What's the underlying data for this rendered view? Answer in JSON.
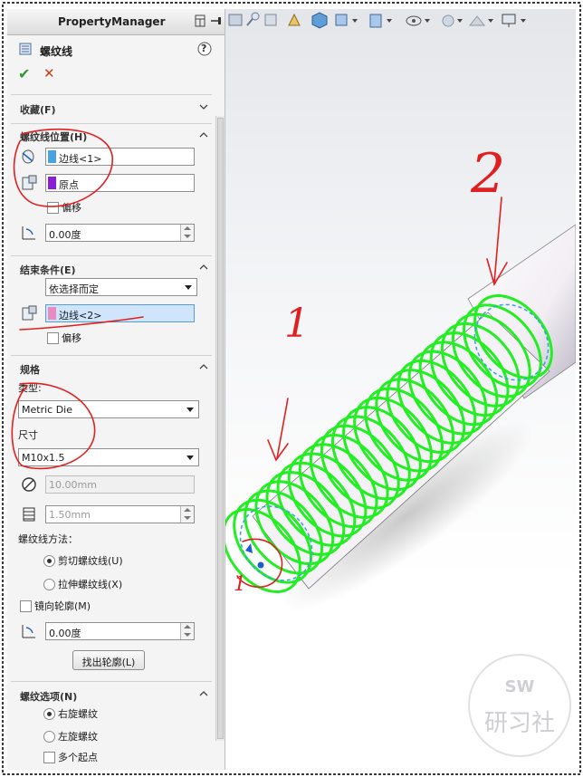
{
  "property_manager": {
    "title": "PropertyManager",
    "feature_name": "螺纹线",
    "help": "?",
    "ok": "✔",
    "cancel": "✕"
  },
  "favorites": {
    "header": "收藏(F)"
  },
  "thread_location": {
    "header": "螺纹线位置(H)",
    "edge_value": "边线<1>",
    "origin_value": "原点",
    "offset_label": "偏移",
    "angle_value": "0.00度"
  },
  "end_condition": {
    "header": "结束条件(E)",
    "type_value": "依选择而定",
    "edge_value": "边线<2>",
    "offset_label": "偏移"
  },
  "specification": {
    "header": "规格",
    "type_label": "类型:",
    "type_value": "Metric Die",
    "size_label": "尺寸",
    "size_value": "M10x1.5",
    "diameter_value": "10.00mm",
    "pitch_value": "1.50mm",
    "method_label": "螺纹线方法：",
    "method_cut": "剪切螺纹线(U)",
    "method_extrude": "拉伸螺纹线(X)",
    "mirror_label": "镜向轮廓(M)",
    "rotate_value": "0.00度",
    "locate_button": "找出轮廓(L)"
  },
  "thread_options": {
    "header": "螺纹选项(N)",
    "right_hand": "右旋螺纹",
    "left_hand": "左旋螺纹",
    "multi_start": "多个起点"
  },
  "annotations": {
    "mark_1": "1",
    "mark_2": "2",
    "mark_start": "1"
  },
  "watermark": {
    "line1": "SW",
    "line2": "研习社"
  },
  "colors": {
    "swatch_blue": "#4aa3df",
    "swatch_purple": "#8a1fd6",
    "swatch_pink": "#e88bc2",
    "thread_green": "#22ee22",
    "annotation_red": "#e02020"
  }
}
